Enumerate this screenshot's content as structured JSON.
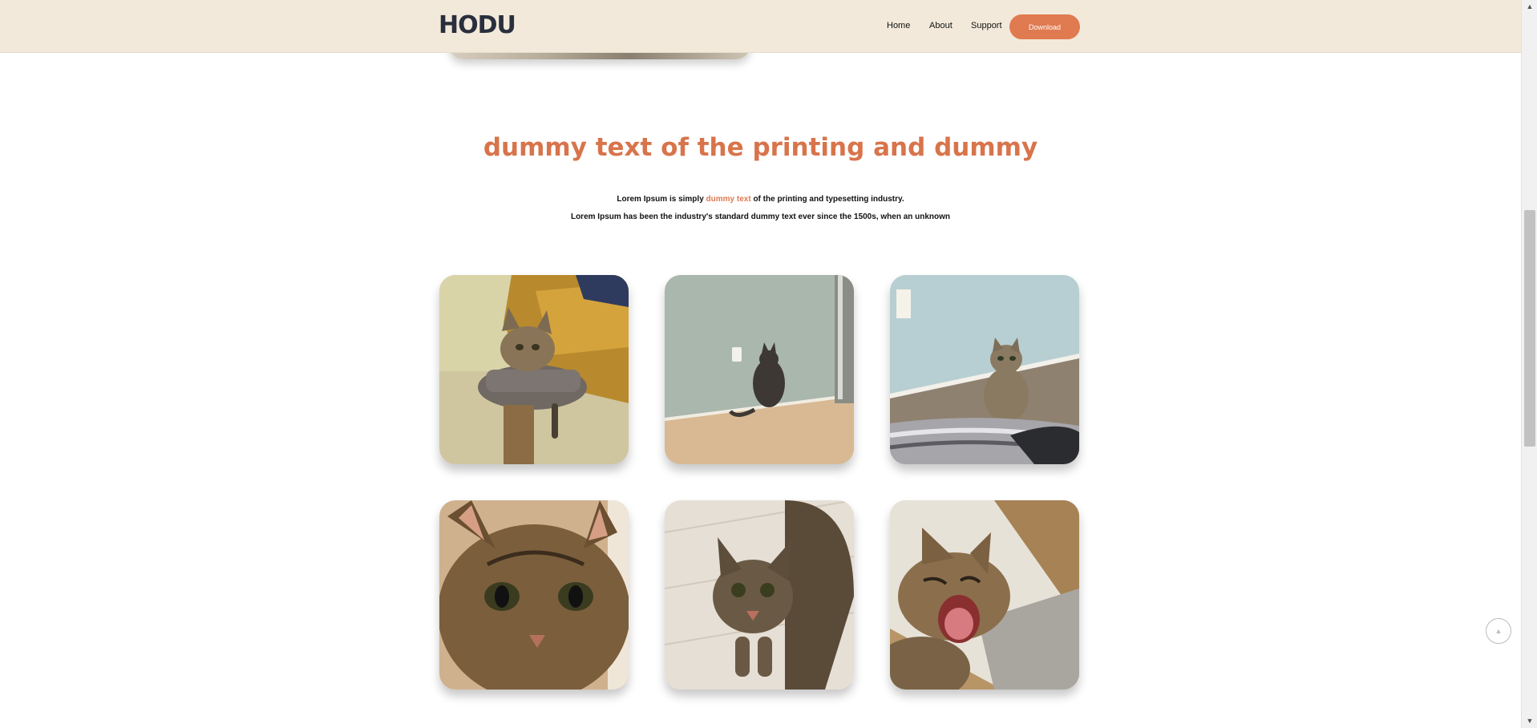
{
  "header": {
    "logo": "HODU",
    "nav": [
      "Home",
      "About",
      "Support"
    ],
    "download_label": "Download"
  },
  "section": {
    "title": "dummy text of the printing and dummy",
    "line1_before": "Lorem Ipsum is simply ",
    "line1_highlight": "dummy text",
    "line1_after": " of the printing and typesetting industry.",
    "line2": "Lorem Ipsum has been the industry's standard dummy text ever since the 1500s, when an unknown"
  },
  "gallery": {
    "photos": [
      "cat-on-scratching-post",
      "cat-facing-wall",
      "cat-sitting-on-blanket",
      "cat-face-closeup",
      "cat-looking-up-floor",
      "cat-yawning"
    ]
  },
  "colors": {
    "accent": "#e07a50",
    "header_bg": "#f2e9da",
    "logo": "#2a2f3d"
  },
  "icons": {
    "back_to_top": "arrow-up-icon",
    "scroll_up": "scroll-up-arrow-icon",
    "scroll_down": "scroll-down-arrow-icon"
  }
}
